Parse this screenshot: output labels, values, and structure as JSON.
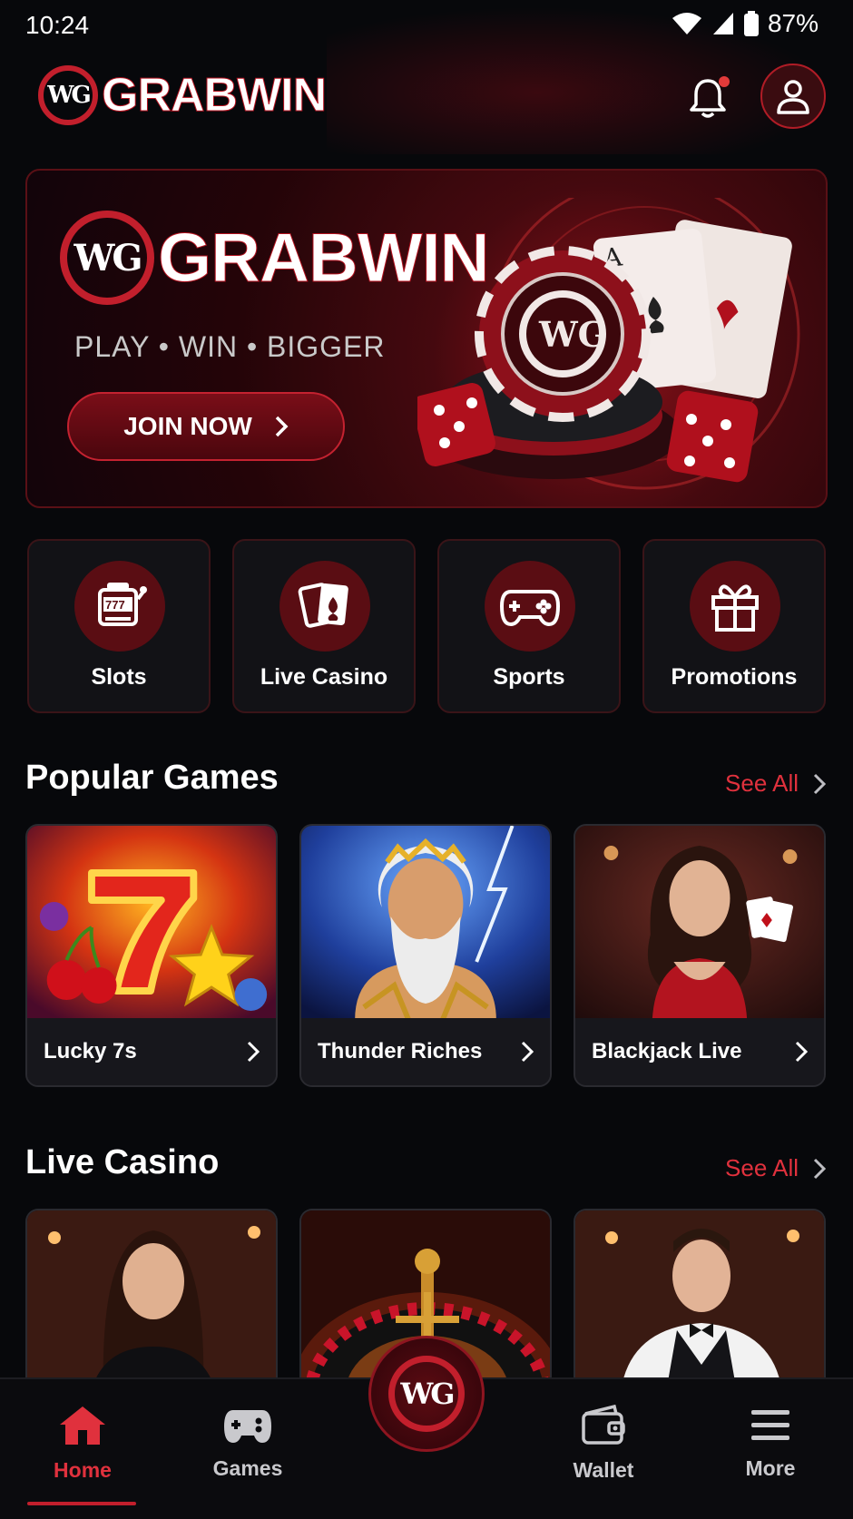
{
  "status_bar": {
    "time": "10:24",
    "battery": "87%"
  },
  "header": {
    "brand": "GRABWIN",
    "logo_mark": "WG",
    "has_notification": true
  },
  "banner": {
    "brand": "GRABWIN",
    "tagline": "PLAY • WIN • BIGGER",
    "cta_label": "JOIN NOW",
    "card_rank": "A"
  },
  "categories": [
    {
      "label": "Slots",
      "icon": "slot-machine-icon",
      "reels": "777"
    },
    {
      "label": "Live Casino",
      "icon": "playing-cards-icon"
    },
    {
      "label": "Sports",
      "icon": "gamepad-icon"
    },
    {
      "label": "Promotions",
      "icon": "gift-icon"
    }
  ],
  "popular_games": {
    "title": "Popular Games",
    "see_all": "See All",
    "items": [
      {
        "name": "Lucky 7s"
      },
      {
        "name": "Thunder Riches"
      },
      {
        "name": "Blackjack Live"
      }
    ]
  },
  "live_casino": {
    "title": "Live Casino",
    "see_all": "See All"
  },
  "bottom_nav": {
    "items": [
      {
        "label": "Home",
        "icon": "home-icon",
        "active": true
      },
      {
        "label": "Games",
        "icon": "gamepad-icon"
      },
      {
        "label": "Wallet",
        "icon": "wallet-icon"
      },
      {
        "label": "More",
        "icon": "menu-icon"
      }
    ],
    "center_logo": "WG"
  },
  "colors": {
    "accent": "#e0313d",
    "brand_red": "#c21f2c",
    "background": "#07080b"
  }
}
